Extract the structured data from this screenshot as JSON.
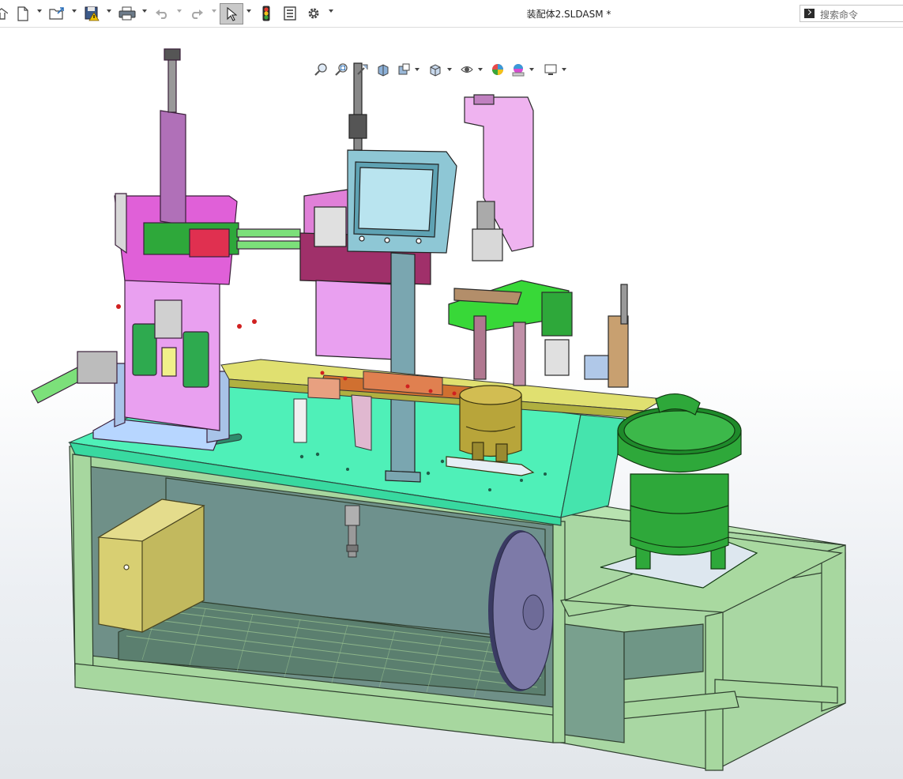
{
  "window": {
    "title": "装配体2.SLDASM *"
  },
  "search": {
    "placeholder": "搜索命令"
  },
  "main_toolbar": {
    "buttons": [
      {
        "icon": "home-icon"
      },
      {
        "icon": "new-document-icon",
        "dropdown": true
      },
      {
        "icon": "open-folder-icon",
        "dropdown": true
      },
      {
        "icon": "save-icon",
        "dropdown": true
      },
      {
        "icon": "print-icon",
        "dropdown": true
      },
      {
        "icon": "undo-icon",
        "dropdown": true,
        "disabled": true
      },
      {
        "icon": "redo-icon",
        "dropdown": true,
        "disabled": true
      },
      {
        "icon": "select-arrow-icon",
        "dropdown": true,
        "active": true
      },
      {
        "icon": "rebuild-traffic-light-icon"
      },
      {
        "icon": "file-properties-icon"
      },
      {
        "icon": "options-gear-icon",
        "dropdown": true
      }
    ]
  },
  "view_toolbar": {
    "buttons": [
      "zoom-to-fit-icon",
      "zoom-to-area-icon",
      "previous-view-icon",
      "section-view-icon",
      "dynamic-annotation-icon",
      "view-orientation-icon",
      "display-style-icon",
      "hide-show-items-icon",
      "edit-appearance-icon",
      "apply-scene-icon",
      "view-settings-icon"
    ]
  },
  "colors": {
    "table_top": "#4ff0b8",
    "frame": "#a7d79f",
    "pink_plate": "#e9a0f0",
    "magenta_plate": "#e060d8",
    "bowl_feeder": "#2ea83a",
    "yellow_box": "#d8cf72",
    "steel_blue": "#7aa6b0",
    "drive_wheel": "#7d7aa8",
    "bronze_part": "#b8a53a"
  },
  "model": {
    "description_icon": "assembly-3d-model"
  }
}
